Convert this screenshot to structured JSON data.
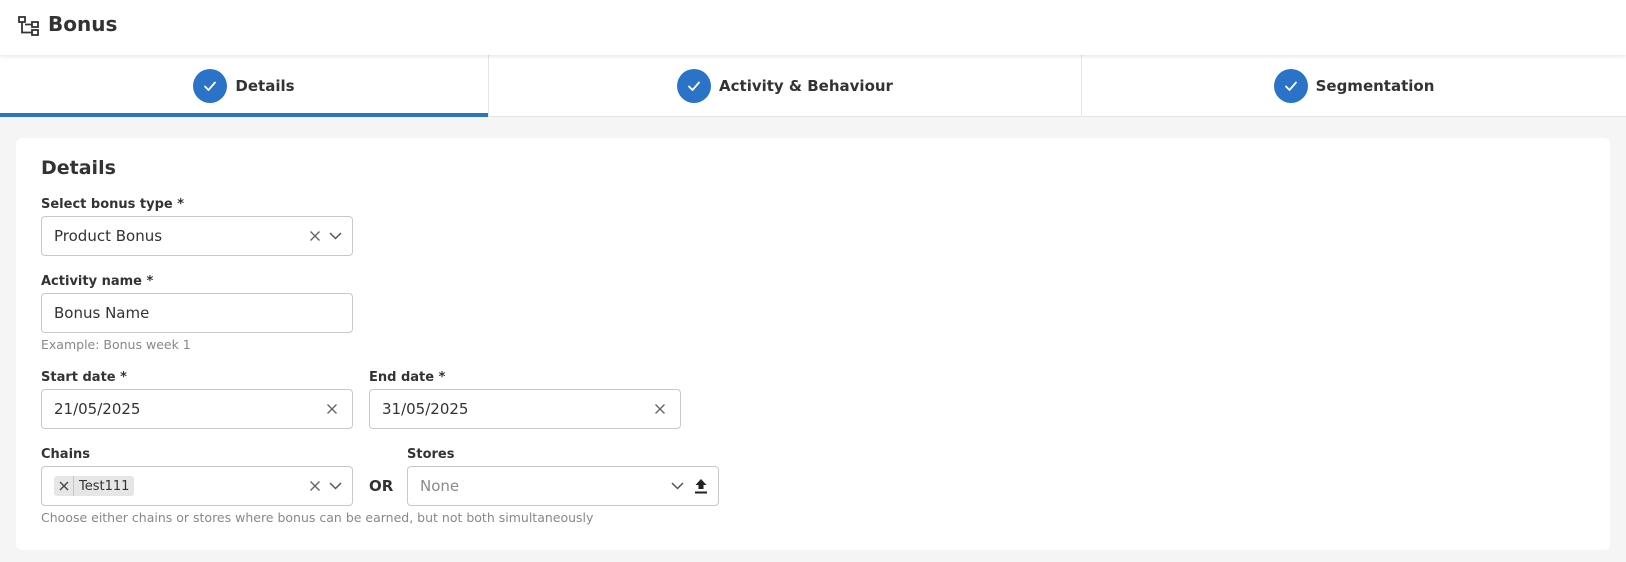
{
  "header": {
    "title": "Bonus",
    "icon": "hierarchy-icon"
  },
  "steps": [
    {
      "label": "Details",
      "completed": true,
      "active": true
    },
    {
      "label": "Activity & Behaviour",
      "completed": true,
      "active": false
    },
    {
      "label": "Segmentation",
      "completed": true,
      "active": false
    }
  ],
  "colors": {
    "accent": "#2a73c9"
  },
  "form": {
    "title": "Details",
    "bonus_type": {
      "label": "Select bonus type *",
      "value": "Product Bonus"
    },
    "activity_name": {
      "label": "Activity name *",
      "value": "Bonus Name",
      "hint": "Example: Bonus week 1"
    },
    "start_date": {
      "label": "Start date *",
      "value": "21/05/2025"
    },
    "end_date": {
      "label": "End date *",
      "value": "31/05/2025"
    },
    "chains": {
      "label": "Chains",
      "chips": [
        "Test111"
      ]
    },
    "or_label": "OR",
    "stores": {
      "label": "Stores",
      "placeholder": "None"
    },
    "location_hint": "Choose either chains or stores where bonus can be earned, but not both simultaneously"
  }
}
